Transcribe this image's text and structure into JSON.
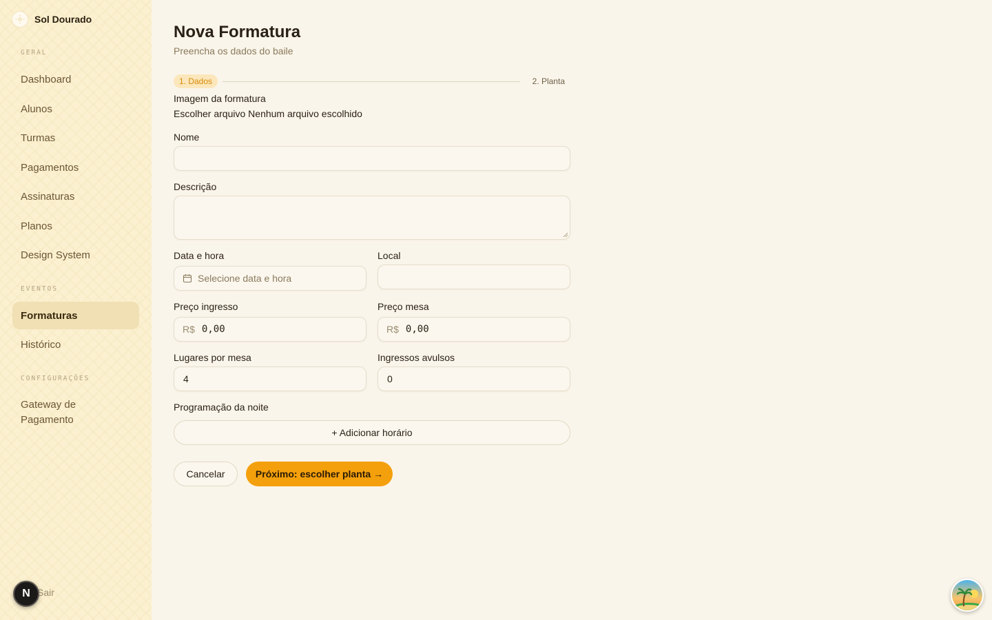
{
  "brand": {
    "name": "Sol Dourado"
  },
  "sidebar": {
    "sections": {
      "geral": "GERAL",
      "eventos": "EVENTOS",
      "configuracoes": "CONFIGURAÇÕES"
    },
    "items": [
      {
        "label": "Dashboard"
      },
      {
        "label": "Alunos"
      },
      {
        "label": "Turmas"
      },
      {
        "label": "Pagamentos"
      },
      {
        "label": "Assinaturas"
      },
      {
        "label": "Planos"
      },
      {
        "label": "Design System"
      },
      {
        "label": "Formaturas",
        "active": true
      },
      {
        "label": "Histórico"
      },
      {
        "label": "Gateway de Pagamento"
      }
    ],
    "logout": "Sair",
    "badge": "N"
  },
  "page": {
    "title": "Nova Formatura",
    "subtitle": "Preencha os dados do baile"
  },
  "stepper": {
    "step1": "1. Dados",
    "step2": "2. Planta"
  },
  "form": {
    "image_label": "Imagem da formatura",
    "file_button": "Escolher arquivo",
    "file_status": "Nenhum arquivo escolhido",
    "nome_label": "Nome",
    "nome_value": "",
    "descricao_label": "Descrição",
    "descricao_value": "",
    "data_label": "Data e hora",
    "data_placeholder": "Selecione data e hora",
    "local_label": "Local",
    "local_value": "",
    "preco_ingresso_label": "Preço ingresso",
    "preco_mesa_label": "Preço mesa",
    "currency": "R$",
    "preco_ingresso_value": "0,00",
    "preco_mesa_value": "0,00",
    "lugares_label": "Lugares por mesa",
    "lugares_value": "4",
    "avulsos_label": "Ingressos avulsos",
    "avulsos_value": "0",
    "programacao_label": "Programação da noite",
    "add_horario": "+ Adicionar horário"
  },
  "actions": {
    "cancel": "Cancelar",
    "next": "Próximo: escolher planta →"
  },
  "colors": {
    "accent": "#f4a00c",
    "sidebar_bg": "#fbf0cf",
    "page_bg": "#faf5ea",
    "active_nav": "#f1e0b4",
    "step_badge": "#fbe7bb"
  }
}
